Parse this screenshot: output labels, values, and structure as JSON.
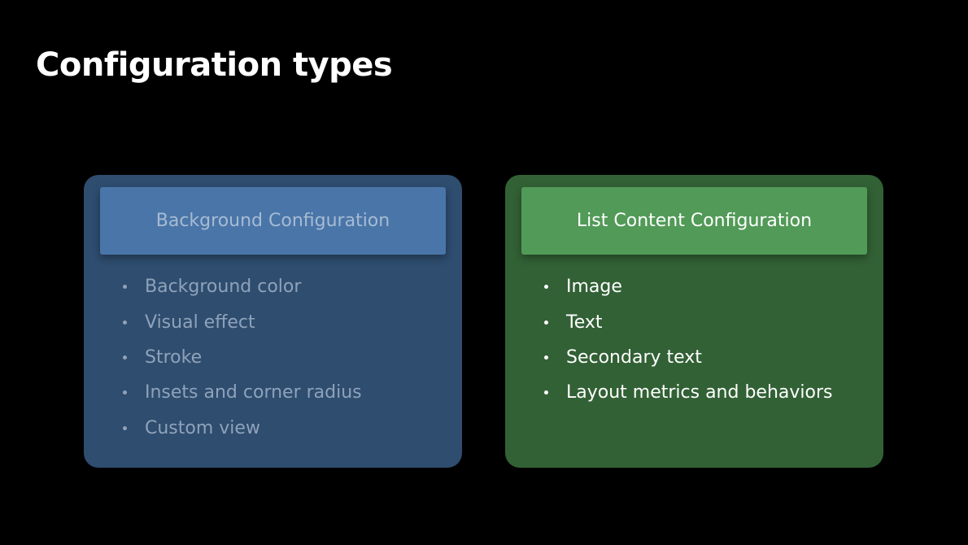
{
  "slide": {
    "title": "Configuration types"
  },
  "cards": [
    {
      "header": "Background Configuration",
      "items": [
        "Background color",
        "Visual effect",
        "Stroke",
        "Insets and corner radius",
        "Custom view"
      ],
      "colors": {
        "card": "#2e4d6f",
        "header": "#4a75a8",
        "text": "#a6bbd3"
      }
    },
    {
      "header": "List Content Configuration",
      "items": [
        "Image",
        "Text",
        "Secondary text",
        "Layout metrics and behaviors"
      ],
      "colors": {
        "card": "#326135",
        "header": "#519a57",
        "text": "#ffffff"
      }
    }
  ]
}
